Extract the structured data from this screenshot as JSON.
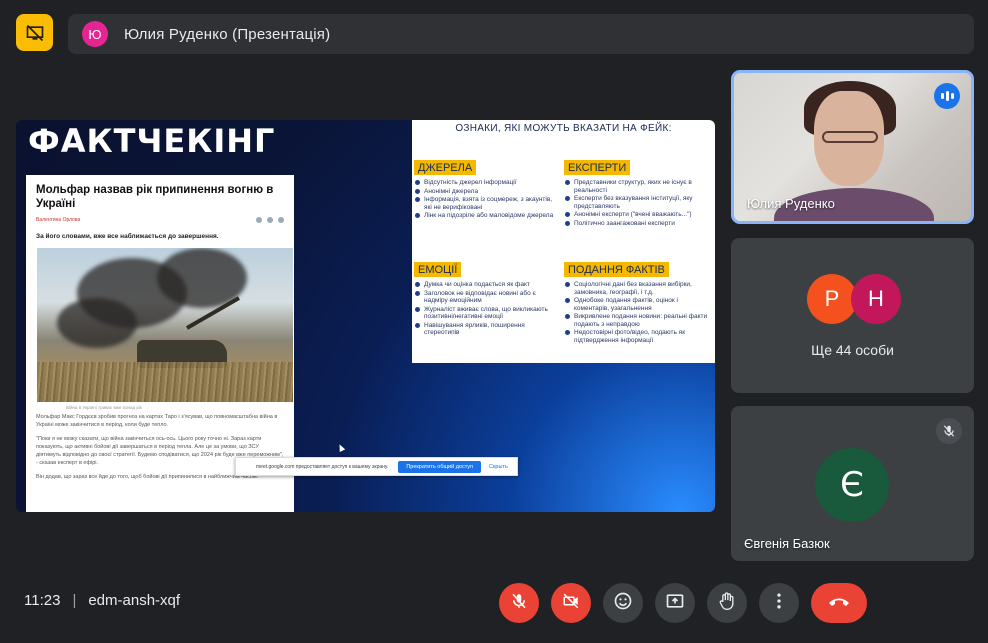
{
  "header": {
    "presenter_initial": "Ю",
    "presenter_title": "Юлия Руденко (Презентація)"
  },
  "slide": {
    "title": "ФАКТЧЕКІНГ",
    "article": {
      "headline": "Мольфар назвав рік припинення вогню в Україні",
      "author": "Валентина Орлова",
      "lead": "За його словами, вже все наближається до завершення.",
      "caption": "Війна в Україні триває вже понад рік",
      "paragraph1": "Мольфар Макс Гордєєв зробив прогноз на картах Таро і з'ясував, що повномасштабна війна в Україні може закінчитися в період, коли буде тепло.",
      "paragraph2": "\"Поки я не можу сказати, що війна закінчиться ось-ось. Цього року точно ні. Зараз карти показують, що активні бойові дії завершаться в період тепла. Але це за умови, що ЗСУ діятимуть відповідно до своєї стратегії. Будемо сподіватися, що 2024 рік буде вже переможним\", - сказав експерт в ефірі.",
      "paragraph3": "Він додав, що зараз все йде до того, щоб бойові дії припинилися в найближчим часом."
    },
    "share_notice": {
      "text": "meet.google.com предоставляет доступ к вашему экрану.",
      "stop_button": "Прекратить общий доступ",
      "hide_button": "Скрыть"
    },
    "signs": {
      "title": "ОЗНАКИ, ЯКІ МОЖУТЬ ВКАЗАТИ НА ФЕЙК:",
      "blocks": [
        {
          "heading": "ДЖЕРЕЛА",
          "items": [
            "Відсутність джерел інформації",
            "Анонімні джерела",
            "Інформація, взята із соцмереж, з акаунтів, які не верифіковані",
            "Лінк на підозріле або маловідоме джерела"
          ]
        },
        {
          "heading": "ЕКСПЕРТИ",
          "items": [
            "Представники структур, яких не існує в реальності",
            "Експерти без вказування інституції, яку представляють",
            "Анонімні експерти (\"вчені вважають...\")",
            "Політично заангажовані експерти"
          ]
        },
        {
          "heading": "ЕМОЦІЇ",
          "items": [
            "Думка чи оцінка подається як факт",
            "Заголовок не відповідає новині або є надміру емоційним",
            "Журналіст вживає слова, що викликають позитивні/негативні емоції",
            "Навішування ярликів, поширення стереотипів"
          ]
        },
        {
          "heading": "ПОДАННЯ ФАКТІВ",
          "items": [
            "Соціологічні дані без вказання вибірки, замовника, географії, і т.д.",
            "Однобоке подання фактів, оцінок і коментарів, узагальнення",
            "Викривлене подання новини: реальні факти подають з неправдою",
            "Недостовірні фото/відео, подають як підтвердження інформації"
          ]
        }
      ]
    }
  },
  "participants": {
    "active_speaker": "Юлия Руденко",
    "others_avatars": [
      {
        "initial": "Р",
        "color": "#f4511e"
      },
      {
        "initial": "Н",
        "color": "#c2185b"
      }
    ],
    "others_label": "Ще 44 особи",
    "muted_participant": {
      "name": "Євгенія Базюк",
      "initial": "Є",
      "color": "#185a3b"
    }
  },
  "footer": {
    "time": "11:23",
    "meeting_code": "edm-ansh-xqf"
  },
  "controls": [
    "mic-off-icon",
    "camera-off-icon",
    "emoji-icon",
    "present-icon",
    "raise-hand-icon",
    "more-options-icon",
    "hang-up-icon"
  ]
}
